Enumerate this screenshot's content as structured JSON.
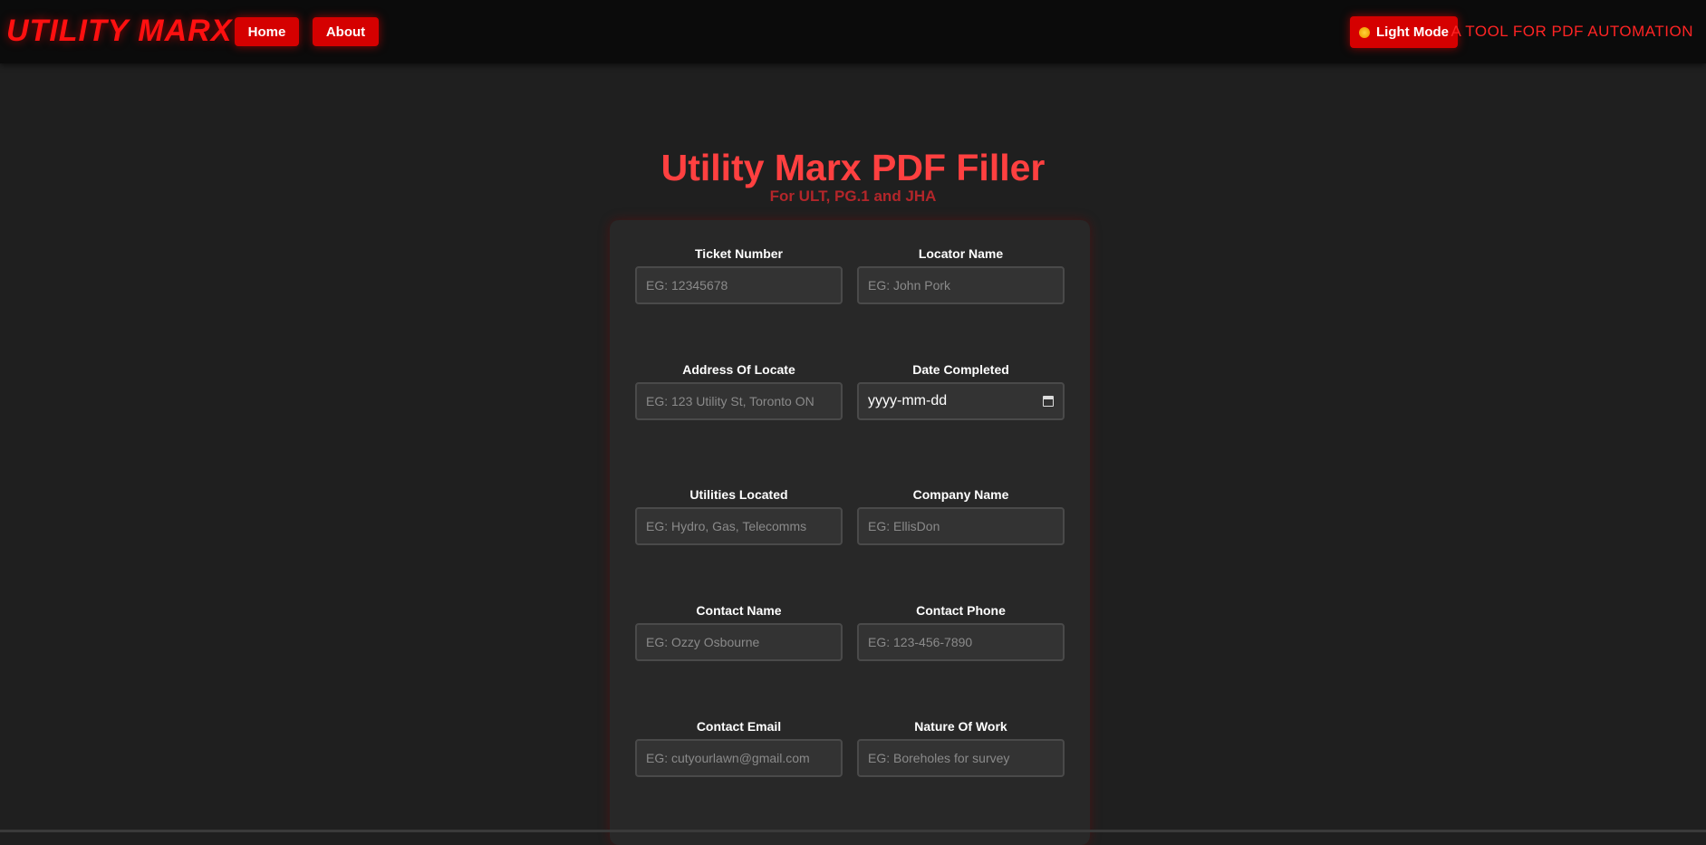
{
  "header": {
    "logo": "UTILITY MARX",
    "nav": [
      {
        "label": "Home"
      },
      {
        "label": "About"
      }
    ],
    "mode_toggle": {
      "label": "Light Mode",
      "icon": "sun-icon"
    },
    "tagline": "A TOOL FOR PDF AUTOMATION"
  },
  "main": {
    "title": "Utility Marx PDF Filler",
    "subtitle": "For ULT, PG.1 and JHA"
  },
  "form": {
    "ticket_number": {
      "label": "Ticket Number",
      "placeholder": "EG: 12345678"
    },
    "locator_name": {
      "label": "Locator Name",
      "placeholder": "EG: John Pork"
    },
    "address_of_locate": {
      "label": "Address Of Locate",
      "placeholder": "EG: 123 Utility St, Toronto ON"
    },
    "date_completed": {
      "label": "Date Completed",
      "placeholder": "yyyy-mm-dd"
    },
    "utilities_located": {
      "label": "Utilities Located",
      "placeholder": "EG: Hydro, Gas, Telecomms"
    },
    "company_name": {
      "label": "Company Name",
      "placeholder": "EG: EllisDon"
    },
    "contact_name": {
      "label": "Contact Name",
      "placeholder": "EG: Ozzy Osbourne"
    },
    "contact_phone": {
      "label": "Contact Phone",
      "placeholder": "EG: 123-456-7890"
    },
    "contact_email": {
      "label": "Contact Email",
      "placeholder": "EG: cutyourlawn@gmail.com"
    },
    "nature_of_work": {
      "label": "Nature Of Work",
      "placeholder": "EG: Boreholes for survey"
    }
  },
  "colors": {
    "accent": "#d50000",
    "logo": "#ff1010",
    "title": "#ff4040",
    "subtitle": "#b3262a",
    "background": "#1f1f1f",
    "card": "#282828"
  }
}
